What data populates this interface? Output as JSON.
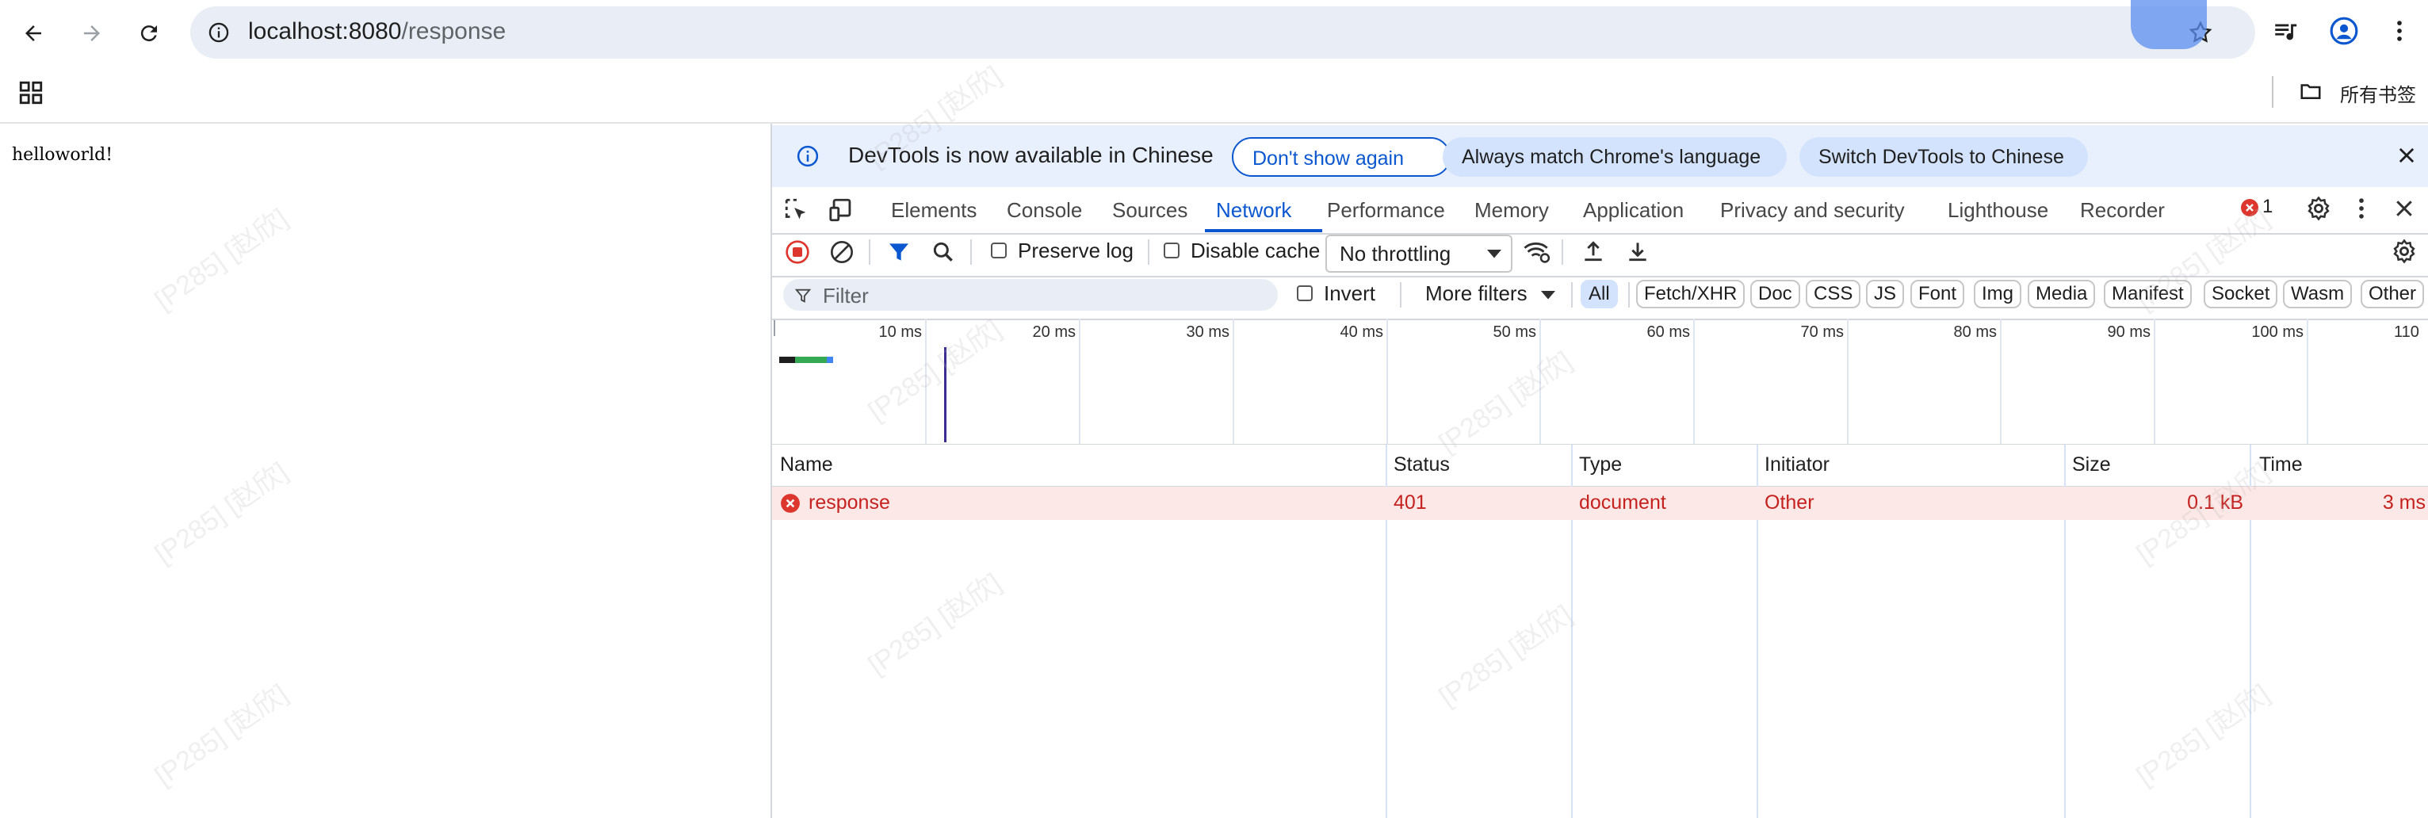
{
  "browser": {
    "url_host": "localhost:8080",
    "url_path": "/response",
    "bookmarks_label": "所有书签"
  },
  "page": {
    "body_text": "helloworld!"
  },
  "devtools": {
    "infobar": {
      "message": "DevTools is now available in Chinese",
      "btn_dont_show": "Don't show again",
      "btn_match": "Always match Chrome's language",
      "btn_switch": "Switch DevTools to Chinese"
    },
    "tabs": [
      "Elements",
      "Console",
      "Sources",
      "Network",
      "Performance",
      "Memory",
      "Application",
      "Privacy and security",
      "Lighthouse",
      "Recorder"
    ],
    "error_count": "1",
    "toolbar": {
      "preserve_log": "Preserve log",
      "disable_cache": "Disable cache",
      "throttling": "No throttling"
    },
    "filter": {
      "placeholder": "Filter",
      "invert": "Invert",
      "more_filters": "More filters",
      "types": [
        "All",
        "Fetch/XHR",
        "Doc",
        "CSS",
        "JS",
        "Font",
        "Img",
        "Media",
        "Manifest",
        "Socket",
        "Wasm",
        "Other"
      ]
    },
    "timeline_ticks": [
      "10 ms",
      "20 ms",
      "30 ms",
      "40 ms",
      "50 ms",
      "60 ms",
      "70 ms",
      "80 ms",
      "90 ms",
      "100 ms",
      "110"
    ],
    "columns": [
      "Name",
      "Status",
      "Type",
      "Initiator",
      "Size",
      "Time"
    ],
    "rows": [
      {
        "name": "response",
        "status": "401",
        "type": "document",
        "initiator": "Other",
        "size": "0.1 kB",
        "time": "3 ms"
      }
    ]
  },
  "watermark": "[P285] [赵欣]",
  "colors": {
    "accent": "#0b57d0",
    "error": "#c5221f",
    "error_row": "#fce8e6",
    "infobar": "#e8f0fe"
  }
}
